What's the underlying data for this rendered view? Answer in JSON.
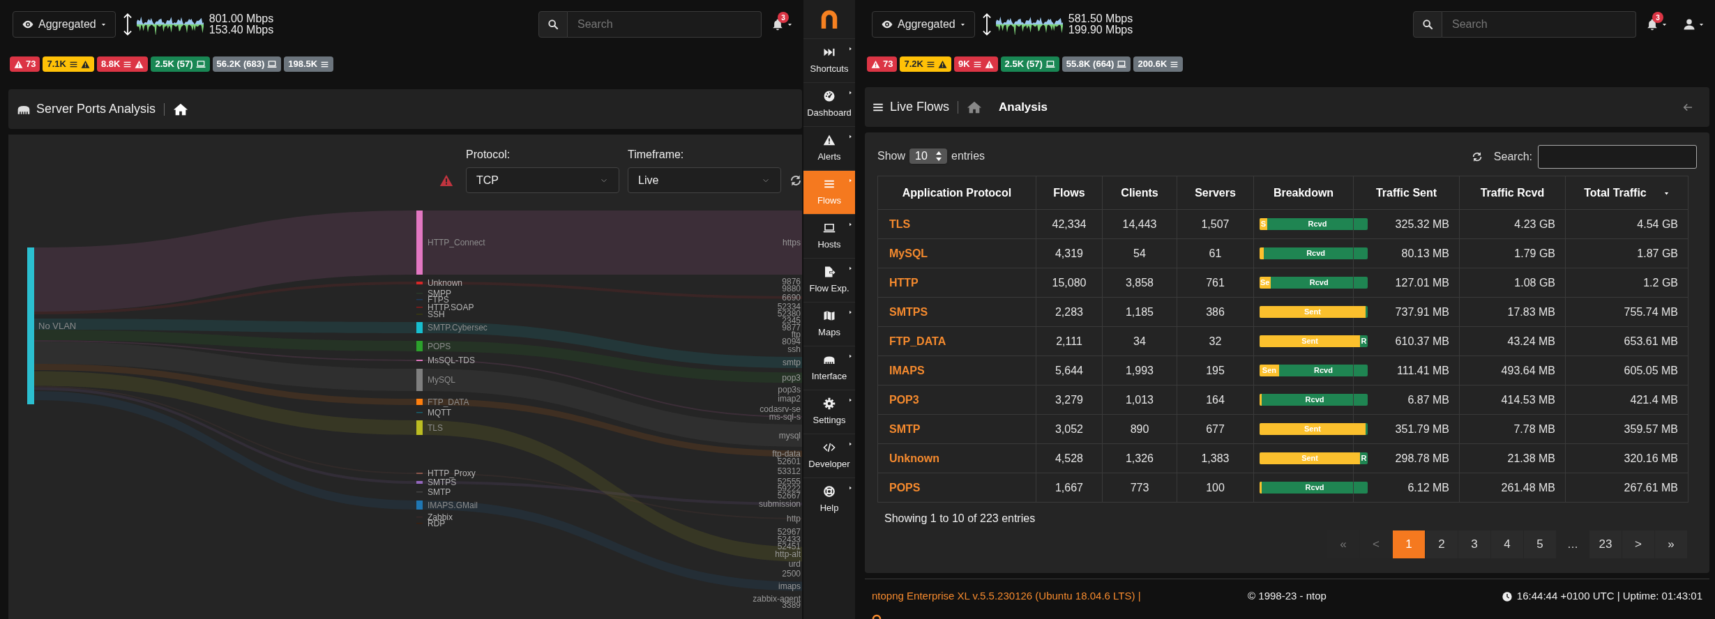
{
  "left_view": {
    "interface_selector": {
      "label": "Aggregated"
    },
    "throughput": {
      "upload": "801.00 Mbps",
      "download": "153.40 Mbps"
    },
    "search": {
      "placeholder": "Search"
    },
    "notifications": {
      "count": "3"
    },
    "badges": [
      {
        "kind": "alerts",
        "text": "73",
        "color": "#dc3545"
      },
      {
        "kind": "flow-alerts",
        "text": "7.1K",
        "color": "#ffc107"
      },
      {
        "kind": "flow-alerts",
        "text": "8.8K",
        "color": "#dc3545"
      },
      {
        "kind": "hosts",
        "text": "2.5K (57)",
        "color": "#198754"
      },
      {
        "kind": "hosts",
        "text": "56.2K (683)",
        "color": "#6c757d"
      },
      {
        "kind": "flows",
        "text": "198.5K",
        "color": "#6c757d"
      }
    ],
    "breadcrumb": {
      "title": "Server Ports Analysis"
    },
    "filters": [
      {
        "label": "Protocol:",
        "value": "TCP"
      },
      {
        "label": "Timeframe:",
        "value": "Live"
      }
    ],
    "sankey": {
      "source": {
        "label": "No VLAN",
        "color": "#2bbfd0"
      },
      "protocols": [
        {
          "label": "HTTP_Connect",
          "color": "#e377c2"
        },
        {
          "label": "Unknown",
          "color": "#d62728"
        },
        {
          "label": "SMPP",
          "color": "#2a3a2a"
        },
        {
          "label": "FTPS",
          "color": "#1f3a5a"
        },
        {
          "label": "HTTP.SOAP",
          "color": "#8b1a1a"
        },
        {
          "label": "SSH",
          "color": "#3a3a10"
        },
        {
          "label": "SMTP.Cybersec",
          "color": "#17becf"
        },
        {
          "label": "POPS",
          "color": "#2ca02c"
        },
        {
          "label": "MsSQL-TDS",
          "color": "#e377c2"
        },
        {
          "label": "MySQL",
          "color": "#7f7f7f"
        },
        {
          "label": "FTP_DATA",
          "color": "#ff7f0e"
        },
        {
          "label": "MQTT",
          "color": "#17606f"
        },
        {
          "label": "TLS",
          "color": "#bcbd22"
        },
        {
          "label": "HTTP_Proxy",
          "color": "#8c564b"
        },
        {
          "label": "SMTPS",
          "color": "#9467bd"
        },
        {
          "label": "SMTP",
          "color": "#444444"
        },
        {
          "label": "IMAPS.GMail",
          "color": "#1f77b4"
        },
        {
          "label": "Zabbix",
          "color": "#3a2a2a"
        },
        {
          "label": "RDP",
          "color": "#3a2010"
        }
      ],
      "ports": [
        "https",
        "9876",
        "9880",
        "6690",
        "52334",
        "52380",
        "2345",
        "9877",
        "ftp",
        "8094",
        "ssh",
        "smtp",
        "pop3",
        "pop3s",
        "imap2",
        "codasrv-se",
        "ms-sql-s",
        "mysql",
        "ftp-data",
        "52601",
        "53312",
        "52555",
        "59222",
        "52667",
        "submission",
        "http",
        "52967",
        "52433",
        "52451",
        "http-alt",
        "urd",
        "2500",
        "imaps",
        "zabbix-agent",
        "3389"
      ]
    }
  },
  "sidebar": {
    "items": [
      {
        "label": "Shortcuts",
        "selected": false
      },
      {
        "label": "Dashboard",
        "selected": false
      },
      {
        "label": "Alerts",
        "selected": false
      },
      {
        "label": "Flows",
        "selected": true
      },
      {
        "label": "Hosts",
        "selected": false
      },
      {
        "label": "Flow Exp.",
        "selected": false
      },
      {
        "label": "Maps",
        "selected": false
      },
      {
        "label": "Interface",
        "selected": false
      },
      {
        "label": "Settings",
        "selected": false
      },
      {
        "label": "Developer",
        "selected": false
      },
      {
        "label": "Help",
        "selected": false
      }
    ]
  },
  "right_view": {
    "interface_selector": {
      "label": "Aggregated"
    },
    "throughput": {
      "upload": "581.50 Mbps",
      "download": "199.90 Mbps"
    },
    "search": {
      "placeholder": "Search"
    },
    "notifications": {
      "count": "3"
    },
    "badges": [
      {
        "kind": "alerts",
        "text": "73",
        "color": "#dc3545"
      },
      {
        "kind": "flow-alerts",
        "text": "7.2K",
        "color": "#ffc107"
      },
      {
        "kind": "flow-alerts",
        "text": "9K",
        "color": "#dc3545"
      },
      {
        "kind": "hosts",
        "text": "2.5K (57)",
        "color": "#198754"
      },
      {
        "kind": "hosts",
        "text": "55.8K (664)",
        "color": "#6c757d"
      },
      {
        "kind": "flows",
        "text": "200.6K",
        "color": "#6c757d"
      }
    ],
    "breadcrumb": {
      "section": "Live Flows",
      "page": "Analysis"
    },
    "table": {
      "length_prefix": "Show",
      "page_length": "10",
      "length_suffix": "entries",
      "search_label": "Search:",
      "columns": [
        {
          "label": "Application Protocol",
          "sorted": false
        },
        {
          "label": "Flows",
          "sorted": false
        },
        {
          "label": "Clients",
          "sorted": false
        },
        {
          "label": "Servers",
          "sorted": false
        },
        {
          "label": "Breakdown",
          "sorted": false
        },
        {
          "label": "Traffic Sent",
          "sorted": false
        },
        {
          "label": "Traffic Rcvd",
          "sorted": false
        },
        {
          "label": "Total Traffic",
          "sorted": true
        }
      ],
      "rows": [
        {
          "protocol": "TLS",
          "flows": "42,334",
          "clients": "14,443",
          "servers": "1,507",
          "level": 0.07,
          "sent_label": "S",
          "rcvd_label": "Rcvd",
          "sent": "325.32 MB",
          "rcvd": "4.23 GB",
          "total": "4.54 GB"
        },
        {
          "protocol": "MySQL",
          "flows": "4,319",
          "clients": "54",
          "servers": "61",
          "level": 0.04,
          "rcvd_label": "Rcvd",
          "sent": "80.13 MB",
          "rcvd": "1.79 GB",
          "total": "1.87 GB"
        },
        {
          "protocol": "HTTP",
          "flows": "15,080",
          "clients": "3,858",
          "servers": "761",
          "level": 0.1,
          "sent_label": "Se",
          "rcvd_label": "Rcvd",
          "sent": "127.01 MB",
          "rcvd": "1.08 GB",
          "total": "1.2 GB"
        },
        {
          "protocol": "SMTPS",
          "flows": "2,283",
          "clients": "1,185",
          "servers": "386",
          "level": 0.98,
          "sent_label": "Sent",
          "sent": "737.91 MB",
          "rcvd": "17.83 MB",
          "total": "755.74 MB"
        },
        {
          "protocol": "FTP_DATA",
          "flows": "2,111",
          "clients": "34",
          "servers": "32",
          "level": 0.93,
          "sent_label": "Sent",
          "rcvd_label": "R",
          "sent": "610.37 MB",
          "rcvd": "43.24 MB",
          "total": "653.61 MB"
        },
        {
          "protocol": "IMAPS",
          "flows": "5,644",
          "clients": "1,993",
          "servers": "195",
          "level": 0.18,
          "sent_label": "Sen",
          "rcvd_label": "Rcvd",
          "sent": "111.41 MB",
          "rcvd": "493.64 MB",
          "total": "605.05 MB"
        },
        {
          "protocol": "POP3",
          "flows": "3,279",
          "clients": "1,013",
          "servers": "164",
          "level": 0.02,
          "rcvd_label": "Rcvd",
          "sent": "6.87 MB",
          "rcvd": "414.53 MB",
          "total": "421.4 MB"
        },
        {
          "protocol": "SMTP",
          "flows": "3,052",
          "clients": "890",
          "servers": "677",
          "level": 0.98,
          "sent_label": "Sent",
          "sent": "351.79 MB",
          "rcvd": "7.78 MB",
          "total": "359.57 MB"
        },
        {
          "protocol": "Unknown",
          "flows": "4,528",
          "clients": "1,326",
          "servers": "1,383",
          "level": 0.93,
          "sent_label": "Sent",
          "rcvd_label": "R",
          "sent": "298.78 MB",
          "rcvd": "21.38 MB",
          "total": "320.16 MB"
        },
        {
          "protocol": "POPS",
          "flows": "1,667",
          "clients": "773",
          "servers": "100",
          "level": 0.02,
          "rcvd_label": "Rcvd",
          "sent": "6.12 MB",
          "rcvd": "261.48 MB",
          "total": "267.61 MB"
        }
      ],
      "info": "Showing 1 to 10 of 223 entries",
      "pagination": [
        {
          "label": "«",
          "kind": "page",
          "selected": false,
          "disabled": true
        },
        {
          "label": "<",
          "kind": "page",
          "selected": false,
          "disabled": true
        },
        {
          "label": "1",
          "kind": "page",
          "selected": true,
          "disabled": false
        },
        {
          "label": "2",
          "kind": "page",
          "selected": false,
          "disabled": false
        },
        {
          "label": "3",
          "kind": "page",
          "selected": false,
          "disabled": false
        },
        {
          "label": "4",
          "kind": "page",
          "selected": false,
          "disabled": false
        },
        {
          "label": "5",
          "kind": "page",
          "selected": false,
          "disabled": false
        },
        {
          "label": "…",
          "kind": "gap"
        },
        {
          "label": "23",
          "kind": "page",
          "selected": false,
          "disabled": false
        },
        {
          "label": ">",
          "kind": "page",
          "selected": false,
          "disabled": false
        },
        {
          "label": "»",
          "kind": "page",
          "selected": false,
          "disabled": false
        }
      ]
    },
    "footer": {
      "version": "ntopng Enterprise XL v.5.5.230126 (Ubuntu 18.04.6 LTS) |",
      "copyright": "© 1998-23 - ntop",
      "time": "16:44:44 +0100 UTC | Uptime: 01:43:01"
    }
  }
}
